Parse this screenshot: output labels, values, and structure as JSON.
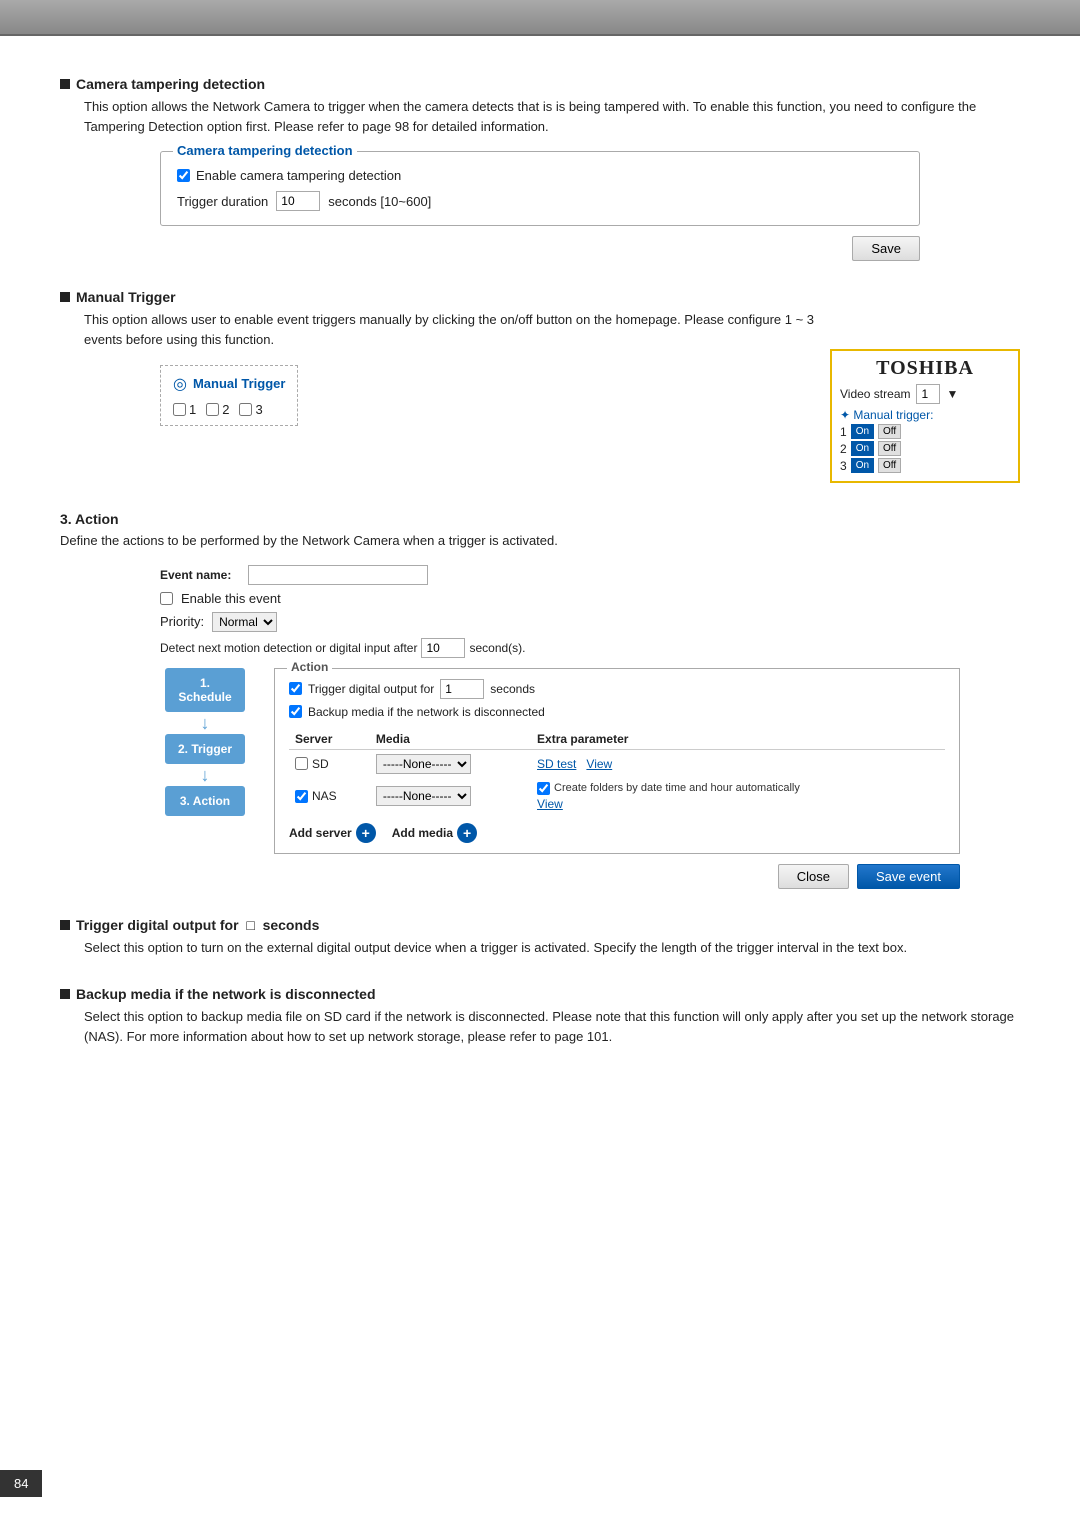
{
  "topbar": {},
  "camera_tampering": {
    "section_title": "Camera tampering detection",
    "desc": "This option allows the Network Camera to trigger when the camera detects that is is being tampered with. To enable this function, you need to configure the Tampering Detection option first. Please refer to page 98 for detailed information.",
    "box_title": "Camera tampering detection",
    "checkbox_label": "Enable camera tampering detection",
    "trigger_duration_label": "Trigger duration",
    "trigger_duration_value": "10",
    "trigger_duration_unit": "seconds [10~600]",
    "save_btn": "Save"
  },
  "manual_trigger": {
    "section_title": "Manual Trigger",
    "desc": "This option allows user to enable event triggers manually by clicking the on/off button on the homepage. Please configure 1 ~ 3 events before using this function.",
    "box_title": "Manual Trigger",
    "num1": "1",
    "num2": "2",
    "num3": "3"
  },
  "toshiba_widget": {
    "brand": "TOSHIBA",
    "stream_label": "Video stream",
    "stream_value": "1",
    "trigger_label": "✦ Manual trigger:",
    "rows": [
      {
        "num": "1",
        "on": "On",
        "off": "Off"
      },
      {
        "num": "2",
        "on": "On",
        "off": "Off"
      },
      {
        "num": "3",
        "on": "On",
        "off": "Off"
      }
    ]
  },
  "action": {
    "section_title": "3. Action",
    "desc": "Define the actions to be performed by the Network Camera when a trigger is activated.",
    "event_name_label": "Event name:",
    "enable_label": "Enable this event",
    "priority_label": "Priority:",
    "priority_value": "Normal",
    "detect_text": "Detect next motion detection or digital input after",
    "detect_value": "10",
    "detect_unit": "second(s).",
    "action_box_title": "Action",
    "trigger_digital_checkbox": "Trigger digital output for",
    "trigger_digital_value": "1",
    "trigger_digital_unit": "seconds",
    "backup_checkbox": "Backup media if the network is disconnected",
    "table_headers": [
      "Server",
      "Media",
      "Extra parameter"
    ],
    "sd_row": {
      "server": "SD",
      "media": "-----None-----",
      "sd_test": "SD test",
      "view": "View"
    },
    "nas_row": {
      "server": "NAS",
      "media": "-----None-----",
      "create_label": "Create folders by date time and hour automatically",
      "view": "View"
    },
    "add_server_label": "Add server",
    "add_media_label": "Add media",
    "close_btn": "Close",
    "save_event_btn": "Save event",
    "steps": [
      {
        "label": "1.  Schedule"
      },
      {
        "label": "2.  Trigger"
      },
      {
        "label": "3.  Action"
      }
    ]
  },
  "trigger_digital_section": {
    "title": "Trigger digital output for",
    "square": "□",
    "unit": "seconds",
    "desc": "Select this option to turn on the external digital output device when a trigger is activated. Specify the length of the trigger interval in the text box."
  },
  "backup_media_section": {
    "title": "Backup media if the network is disconnected",
    "desc": "Select this option to backup media file on SD card if the network is disconnected. Please note that this function will only apply after you set up the network storage (NAS). For more information about how to set up network storage, please refer to page 101."
  },
  "page_number": "84"
}
